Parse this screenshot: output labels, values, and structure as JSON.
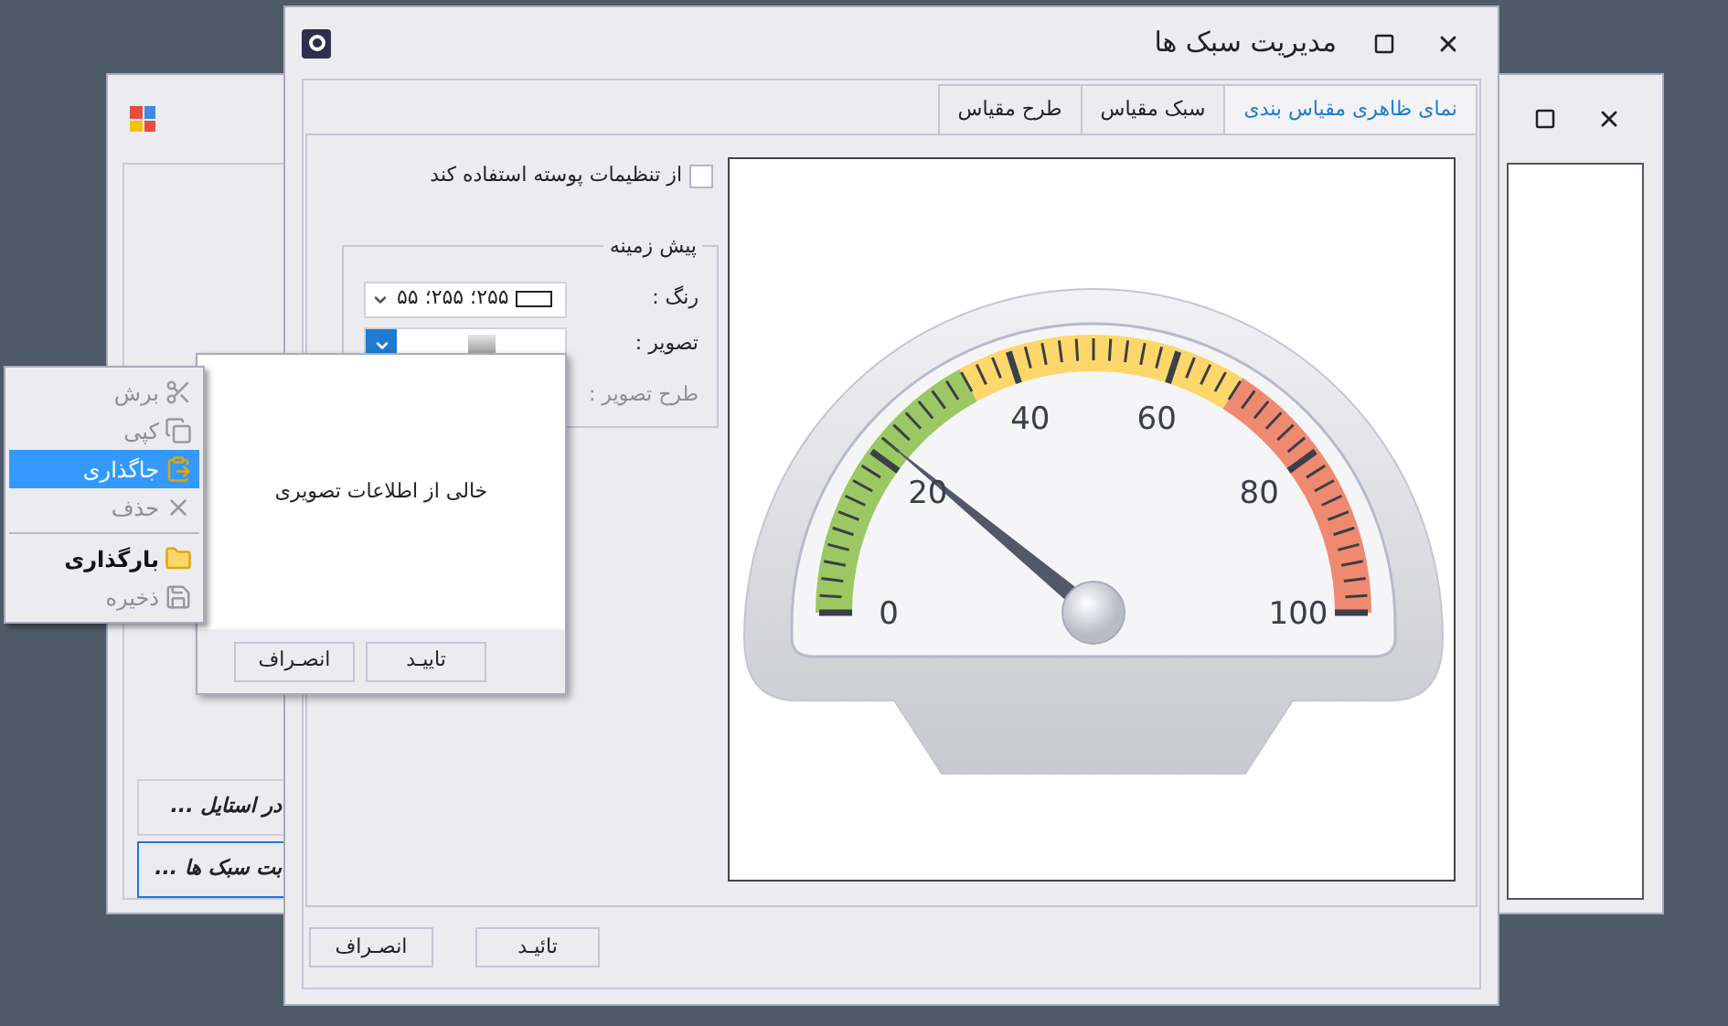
{
  "back_window": {
    "buttons": [
      {
        "label": "در استایل ...",
        "selected": false
      },
      {
        "label": "بت سبک ها ...",
        "selected": true
      }
    ]
  },
  "dialog": {
    "title": "مدیریت سبک ها",
    "tabs": [
      {
        "label": "نمای ظاهری مقیاس بندی",
        "selected": true
      },
      {
        "label": "سبک مقیاس",
        "selected": false
      },
      {
        "label": "طرح مقیاس",
        "selected": false
      }
    ],
    "use_theme": {
      "label": "از تنظیمات پوسته استفاده کند",
      "checked": false
    },
    "background_group": {
      "title": "پیش زمینه",
      "color_label": "رنگ :",
      "color_value": "۲۵۵؛ ۲۵۵؛ ۵۵",
      "image_label": "تصویر :",
      "image_layout_label": "طرح تصویر :",
      "image_layout_disabled": true
    },
    "gauge": {
      "level": 0.22,
      "labels": [
        "0",
        "20",
        "40",
        "60",
        "80",
        "100"
      ]
    },
    "buttons": [
      "تائیـد",
      "انصـراف"
    ]
  },
  "image_popup": {
    "message": "خالی از اطلاعات تصویری",
    "buttons": [
      "تاییـد",
      "انصـراف"
    ]
  },
  "context_menu": {
    "items": [
      {
        "kind": "command",
        "label": "برش",
        "disabled": true,
        "selected": false
      },
      {
        "kind": "command",
        "label": "کپی",
        "disabled": true,
        "selected": false
      },
      {
        "kind": "command",
        "label": "جاگذاری",
        "disabled": false,
        "selected": true
      },
      {
        "kind": "command",
        "label": "حذف",
        "disabled": true,
        "selected": false
      },
      {
        "kind": "separator"
      },
      {
        "kind": "command",
        "label": "بارگذاری",
        "disabled": false,
        "selected": false
      },
      {
        "kind": "command",
        "label": "ذخیره",
        "disabled": true,
        "selected": false
      }
    ]
  }
}
